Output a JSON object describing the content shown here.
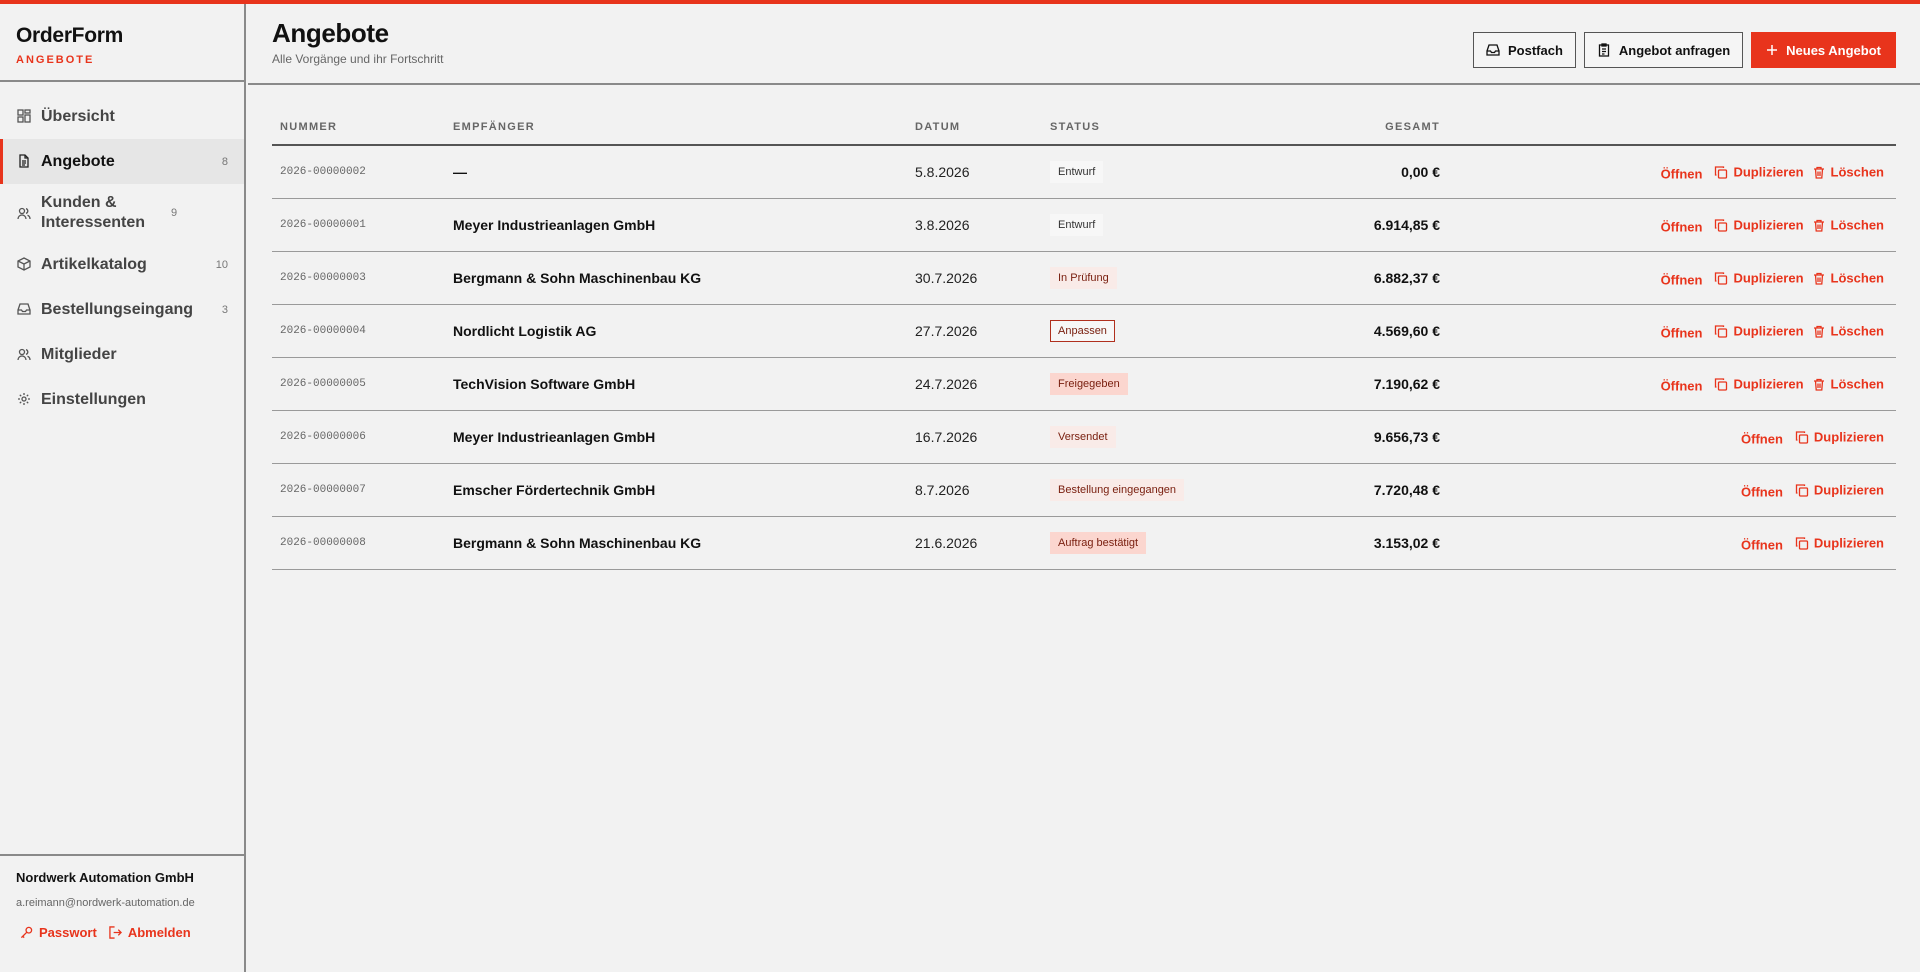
{
  "brand": {
    "name": "OrderForm",
    "section": "ANGEBOTE"
  },
  "sidebar": {
    "items": [
      {
        "label": "Übersicht",
        "count": ""
      },
      {
        "label": "Angebote",
        "count": "8"
      },
      {
        "label": "Kunden & Interessenten",
        "count": "9"
      },
      {
        "label": "Artikelkatalog",
        "count": "10"
      },
      {
        "label": "Bestellungseingang",
        "count": "3"
      },
      {
        "label": "Mitglieder",
        "count": ""
      },
      {
        "label": "Einstellungen",
        "count": ""
      }
    ],
    "footer": {
      "org": "Nordwerk Automation GmbH",
      "email": "a.reimann@nordwerk-automation.de",
      "password_label": "Passwort",
      "logout_label": "Abmelden"
    }
  },
  "header": {
    "title": "Angebote",
    "subtitle": "Alle Vorgänge und ihr Fortschritt",
    "buttons": {
      "inbox": "Postfach",
      "request": "Angebot anfragen",
      "new": "Neues Angebot"
    }
  },
  "table": {
    "columns": {
      "number": "NUMMER",
      "recipient": "EMPFÄNGER",
      "date": "DATUM",
      "status": "STATUS",
      "total": "GESAMT"
    },
    "actions": {
      "open": "Öffnen",
      "duplicate": "Duplizieren",
      "delete": "Löschen"
    },
    "rows": [
      {
        "number": "2026-00000002",
        "recipient": "—",
        "date": "5.8.2026",
        "status": "Entwurf",
        "total": "0,00 €"
      },
      {
        "number": "2026-00000001",
        "recipient": "Meyer Industrieanlagen GmbH",
        "date": "3.8.2026",
        "status": "Entwurf",
        "total": "6.914,85 €"
      },
      {
        "number": "2026-00000003",
        "recipient": "Bergmann & Sohn Maschinenbau KG",
        "date": "30.7.2026",
        "status": "In Prüfung",
        "total": "6.882,37 €"
      },
      {
        "number": "2026-00000004",
        "recipient": "Nordlicht Logistik AG",
        "date": "27.7.2026",
        "status": "Anpassen",
        "total": "4.569,60 €"
      },
      {
        "number": "2026-00000005",
        "recipient": "TechVision Software GmbH",
        "date": "24.7.2026",
        "status": "Freigegeben",
        "total": "7.190,62 €"
      },
      {
        "number": "2026-00000006",
        "recipient": "Meyer Industrieanlagen GmbH",
        "date": "16.7.2026",
        "status": "Versendet",
        "total": "9.656,73 €"
      },
      {
        "number": "2026-00000007",
        "recipient": "Emscher Fördertechnik GmbH",
        "date": "8.7.2026",
        "status": "Bestellung eingegangen",
        "total": "7.720,48 €"
      },
      {
        "number": "2026-00000008",
        "recipient": "Bergmann & Sohn Maschinenbau KG",
        "date": "21.6.2026",
        "status": "Auftrag bestätigt",
        "total": "3.153,02 €"
      }
    ]
  },
  "colors": {
    "accent": "#e8341c",
    "background": "#f2f2f2",
    "text": "#111111"
  },
  "icons": {
    "nav": [
      "grid-icon",
      "document-icon",
      "users-icon",
      "box-icon",
      "inbox-icon",
      "users-icon",
      "gear-icon"
    ],
    "actions": [
      "copy-icon",
      "trash-icon"
    ],
    "footer": [
      "key-icon",
      "logout-icon"
    ]
  }
}
